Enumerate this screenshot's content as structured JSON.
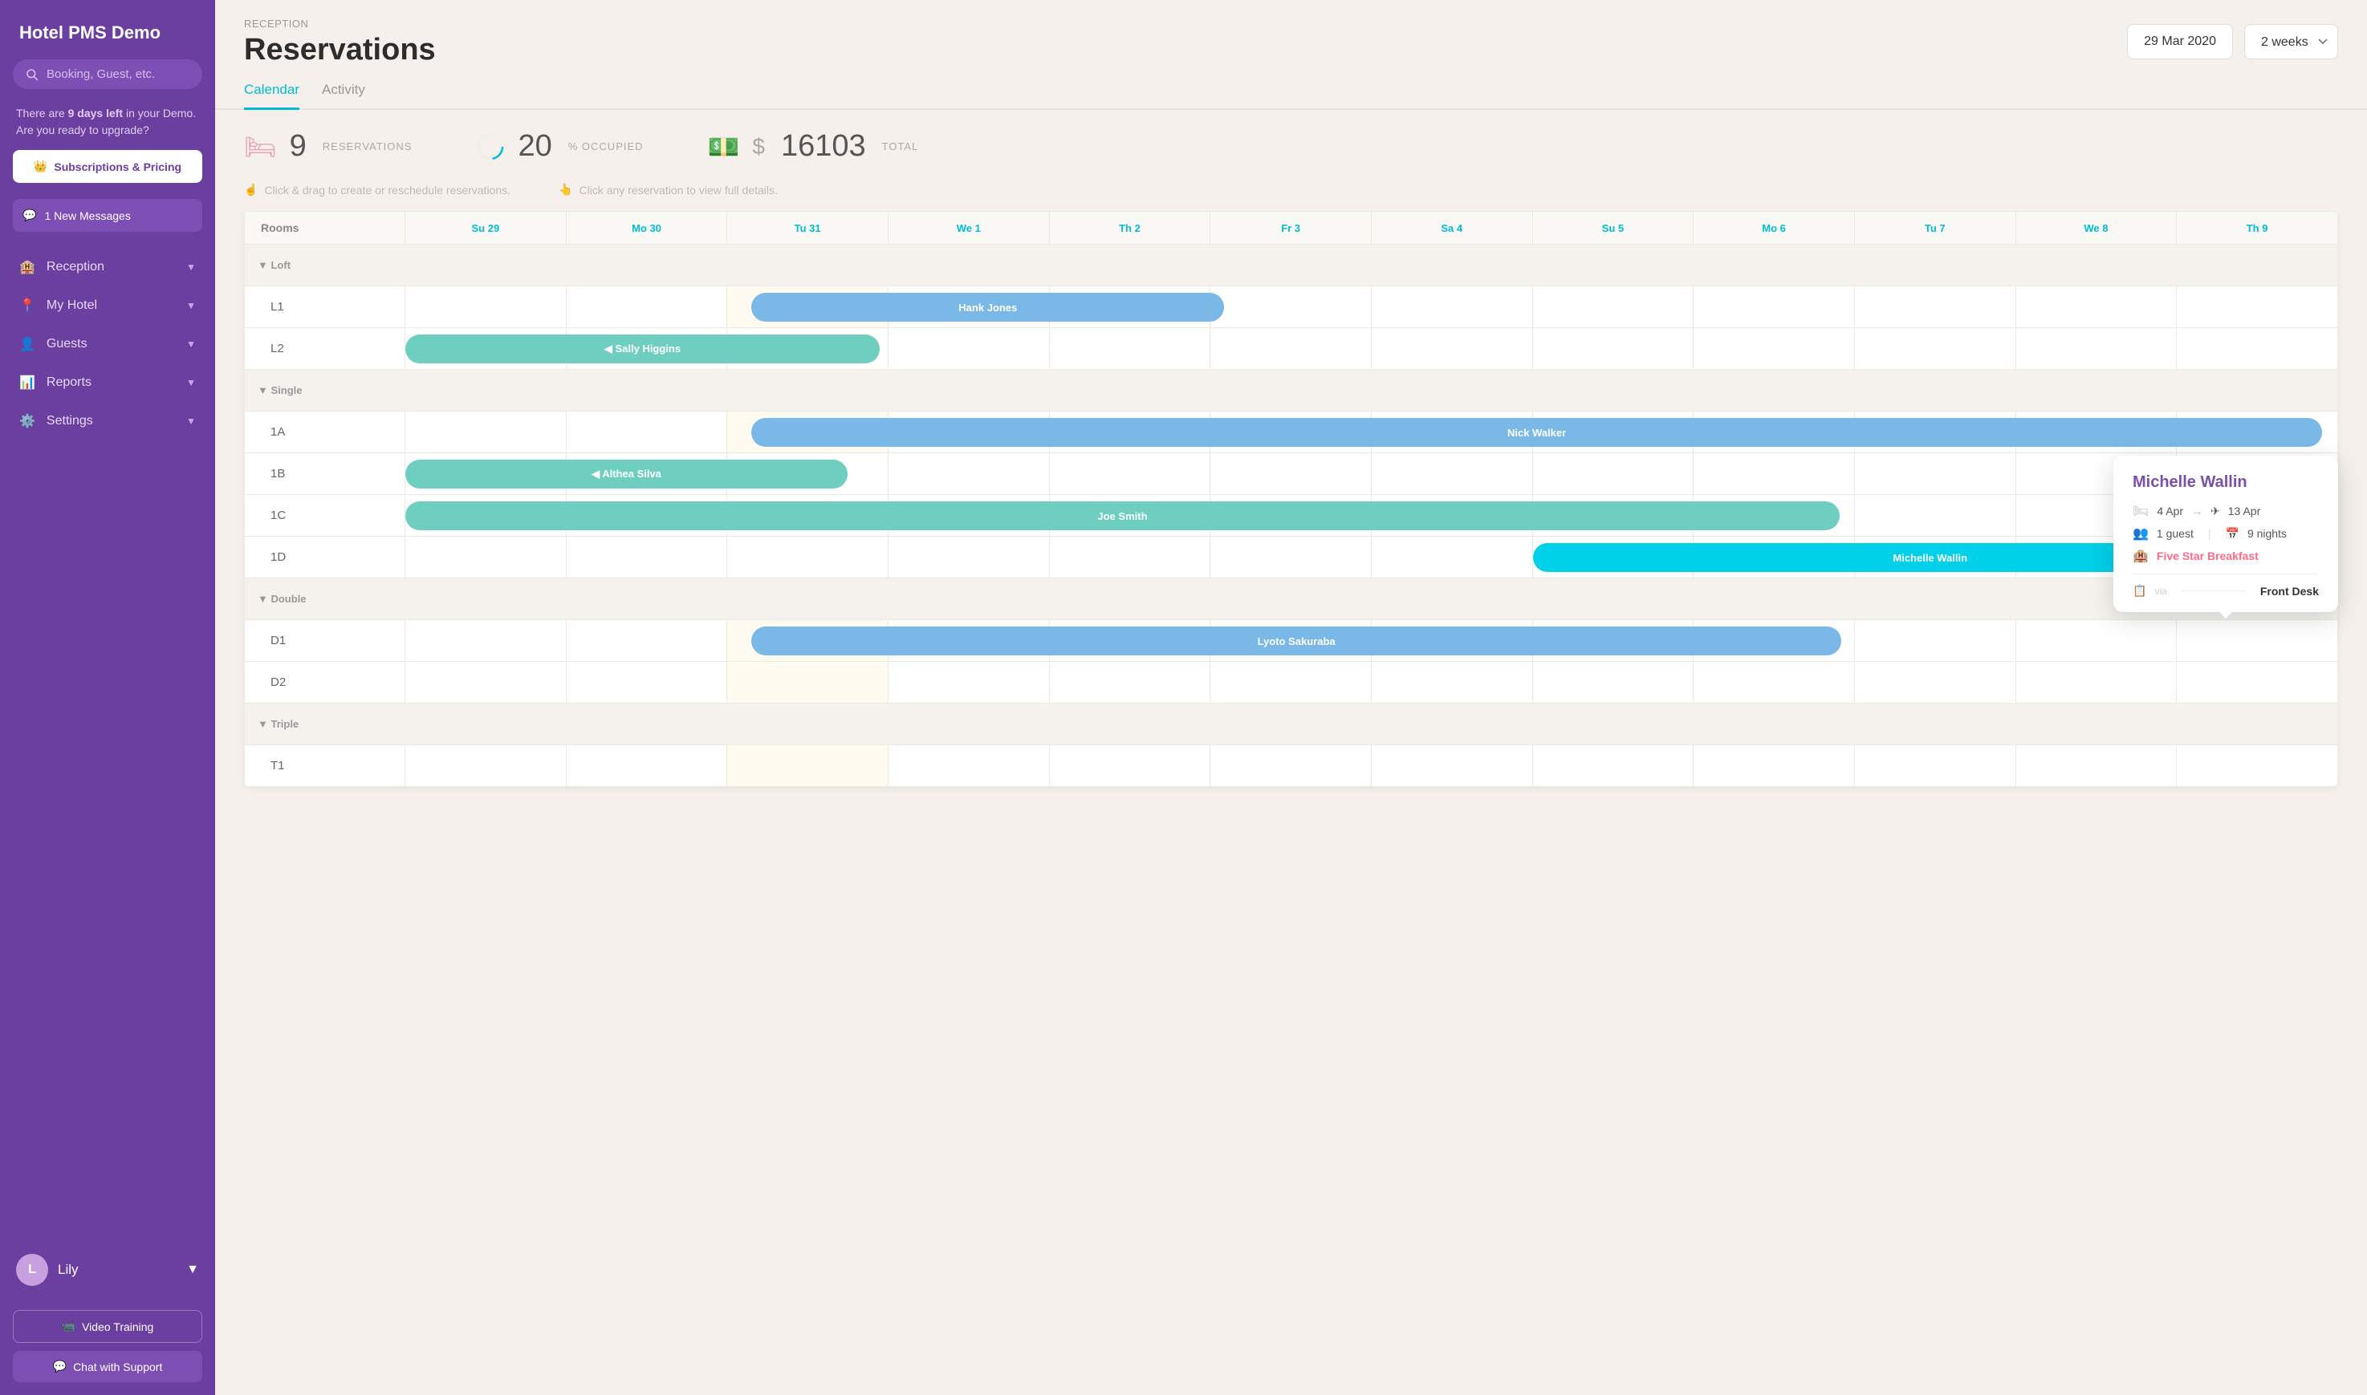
{
  "sidebar": {
    "logo": "Hotel PMS Demo",
    "search_placeholder": "Booking, Guest, etc.",
    "demo_notice_prefix": "There are ",
    "demo_days": "9 days left",
    "demo_notice_suffix": " in your Demo. Are you ready to upgrade?",
    "upgrade_label": "Subscriptions & Pricing",
    "messages_label": "1 New Messages",
    "nav_items": [
      {
        "id": "reception",
        "label": "Reception",
        "icon": "🏨"
      },
      {
        "id": "my-hotel",
        "label": "My Hotel",
        "icon": "📍"
      },
      {
        "id": "guests",
        "label": "Guests",
        "icon": "👤"
      },
      {
        "id": "reports",
        "label": "Reports",
        "icon": "📊"
      },
      {
        "id": "settings",
        "label": "Settings",
        "icon": "⚙️"
      }
    ],
    "video_training_label": "Video Training",
    "chat_support_label": "Chat with Support",
    "user": {
      "name": "Lily",
      "avatar_initial": "L"
    }
  },
  "header": {
    "breadcrumb": "RECEPTION",
    "title": "Reservations",
    "date": "29 Mar 2020",
    "weeks": "2 weeks"
  },
  "tabs": [
    {
      "id": "calendar",
      "label": "Calendar",
      "active": true
    },
    {
      "id": "activity",
      "label": "Activity",
      "active": false
    }
  ],
  "stats": {
    "reservations_count": "9",
    "reservations_label": "RESERVATIONS",
    "occupied_percent": "20",
    "occupied_label": "% OCCUPIED",
    "total_label": "TOTAL",
    "total_currency": "$",
    "total_amount": "16103"
  },
  "hints": {
    "hint1": "Click & drag to create or reschedule reservations.",
    "hint2": "Click any reservation to view full details."
  },
  "calendar": {
    "rooms_label": "Rooms",
    "columns": [
      "Su 29",
      "Mo 30",
      "Tu 31",
      "We 1",
      "Th 2",
      "Fr 3",
      "Sa 4",
      "Su 5",
      "Mo 6",
      "Tu 7",
      "We 8",
      "Th 9"
    ],
    "groups": [
      {
        "name": "Loft",
        "rooms": [
          {
            "id": "L1",
            "bars": [
              {
                "name": "Hank Jones",
                "color": "bar-blue",
                "start": 2,
                "span": 3
              }
            ]
          },
          {
            "id": "L2",
            "bars": [
              {
                "name": "Sally Higgins",
                "color": "bar-teal",
                "start": 0,
                "span": 3
              }
            ]
          }
        ]
      },
      {
        "name": "Single",
        "rooms": [
          {
            "id": "1A",
            "bars": [
              {
                "name": "Nick Walker",
                "color": "bar-blue",
                "start": 2,
                "span": 10
              }
            ]
          },
          {
            "id": "1B",
            "bars": [
              {
                "name": "Althea Silva",
                "color": "bar-teal",
                "start": 0,
                "span": 3
              }
            ]
          },
          {
            "id": "1C",
            "bars": [
              {
                "name": "Joe Smith",
                "color": "bar-teal",
                "start": 0,
                "span": 9
              }
            ]
          },
          {
            "id": "1D",
            "bars": [
              {
                "name": "Michelle Wallin",
                "color": "bar-cyan",
                "start": 7,
                "span": 5
              }
            ]
          }
        ]
      },
      {
        "name": "Double",
        "rooms": [
          {
            "id": "D1",
            "bars": [
              {
                "name": "Lyoto Sakuraba",
                "color": "bar-blue",
                "start": 2,
                "span": 7
              }
            ]
          },
          {
            "id": "D2",
            "bars": []
          }
        ]
      },
      {
        "name": "Triple",
        "rooms": [
          {
            "id": "T1",
            "bars": []
          }
        ]
      }
    ]
  },
  "tooltip": {
    "name": "Michelle Wallin",
    "checkin": "4 Apr",
    "checkout": "13 Apr",
    "guests": "1 guest",
    "nights": "9 nights",
    "package": "Five Star Breakfast",
    "via_label": "via",
    "channel": "Front Desk",
    "checkin_icon": "🛏",
    "checkout_icon": "✈",
    "guests_icon": "👥",
    "calendar_icon": "📅",
    "channel_icon": "📋"
  }
}
